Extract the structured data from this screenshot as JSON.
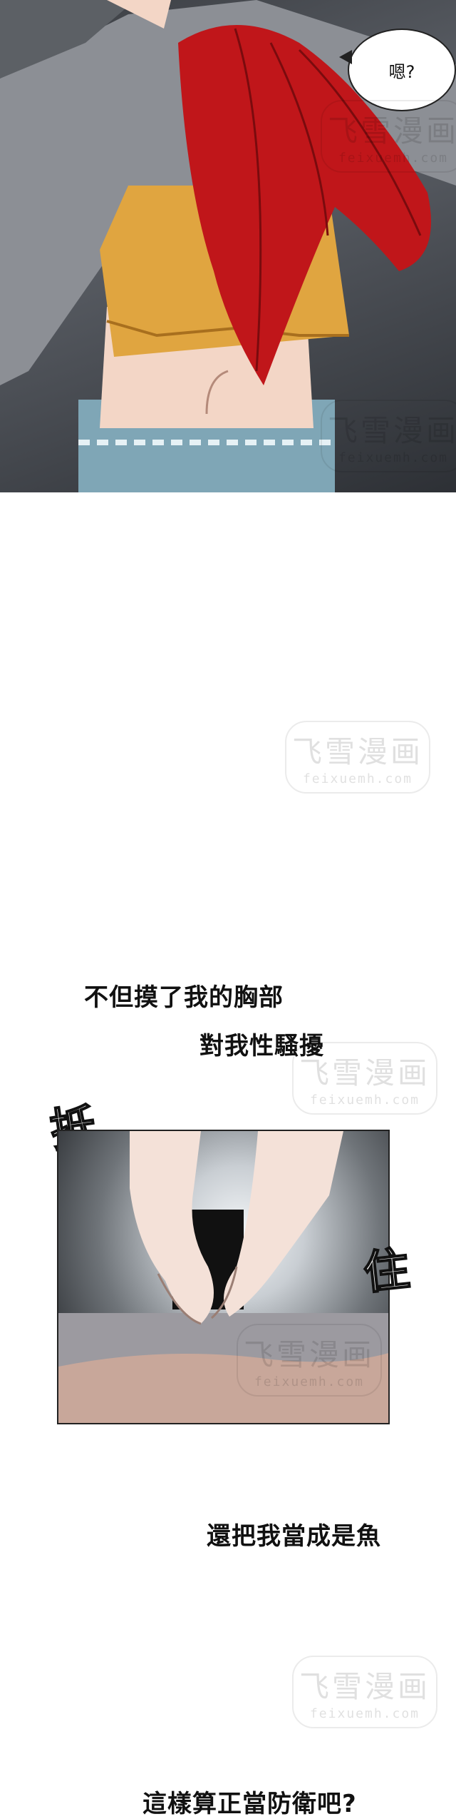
{
  "panel_top": {
    "bubble_text": "嗯?"
  },
  "captions": [
    {
      "text": "不但摸了我的胸部"
    },
    {
      "text": "對我性騷擾"
    },
    {
      "text": "還把我當成是魚"
    },
    {
      "text": "這樣算正當防衛吧?"
    }
  ],
  "sfx": [
    {
      "text": "抵"
    },
    {
      "text": "住"
    }
  ],
  "watermark": {
    "title": "飞雪漫画",
    "url": "feixuemh.com"
  },
  "colors": {
    "hair": "#c0161a",
    "shirt": "#e0a540",
    "jeans": "#7fa6b6",
    "jacket": "#8c8f95"
  }
}
